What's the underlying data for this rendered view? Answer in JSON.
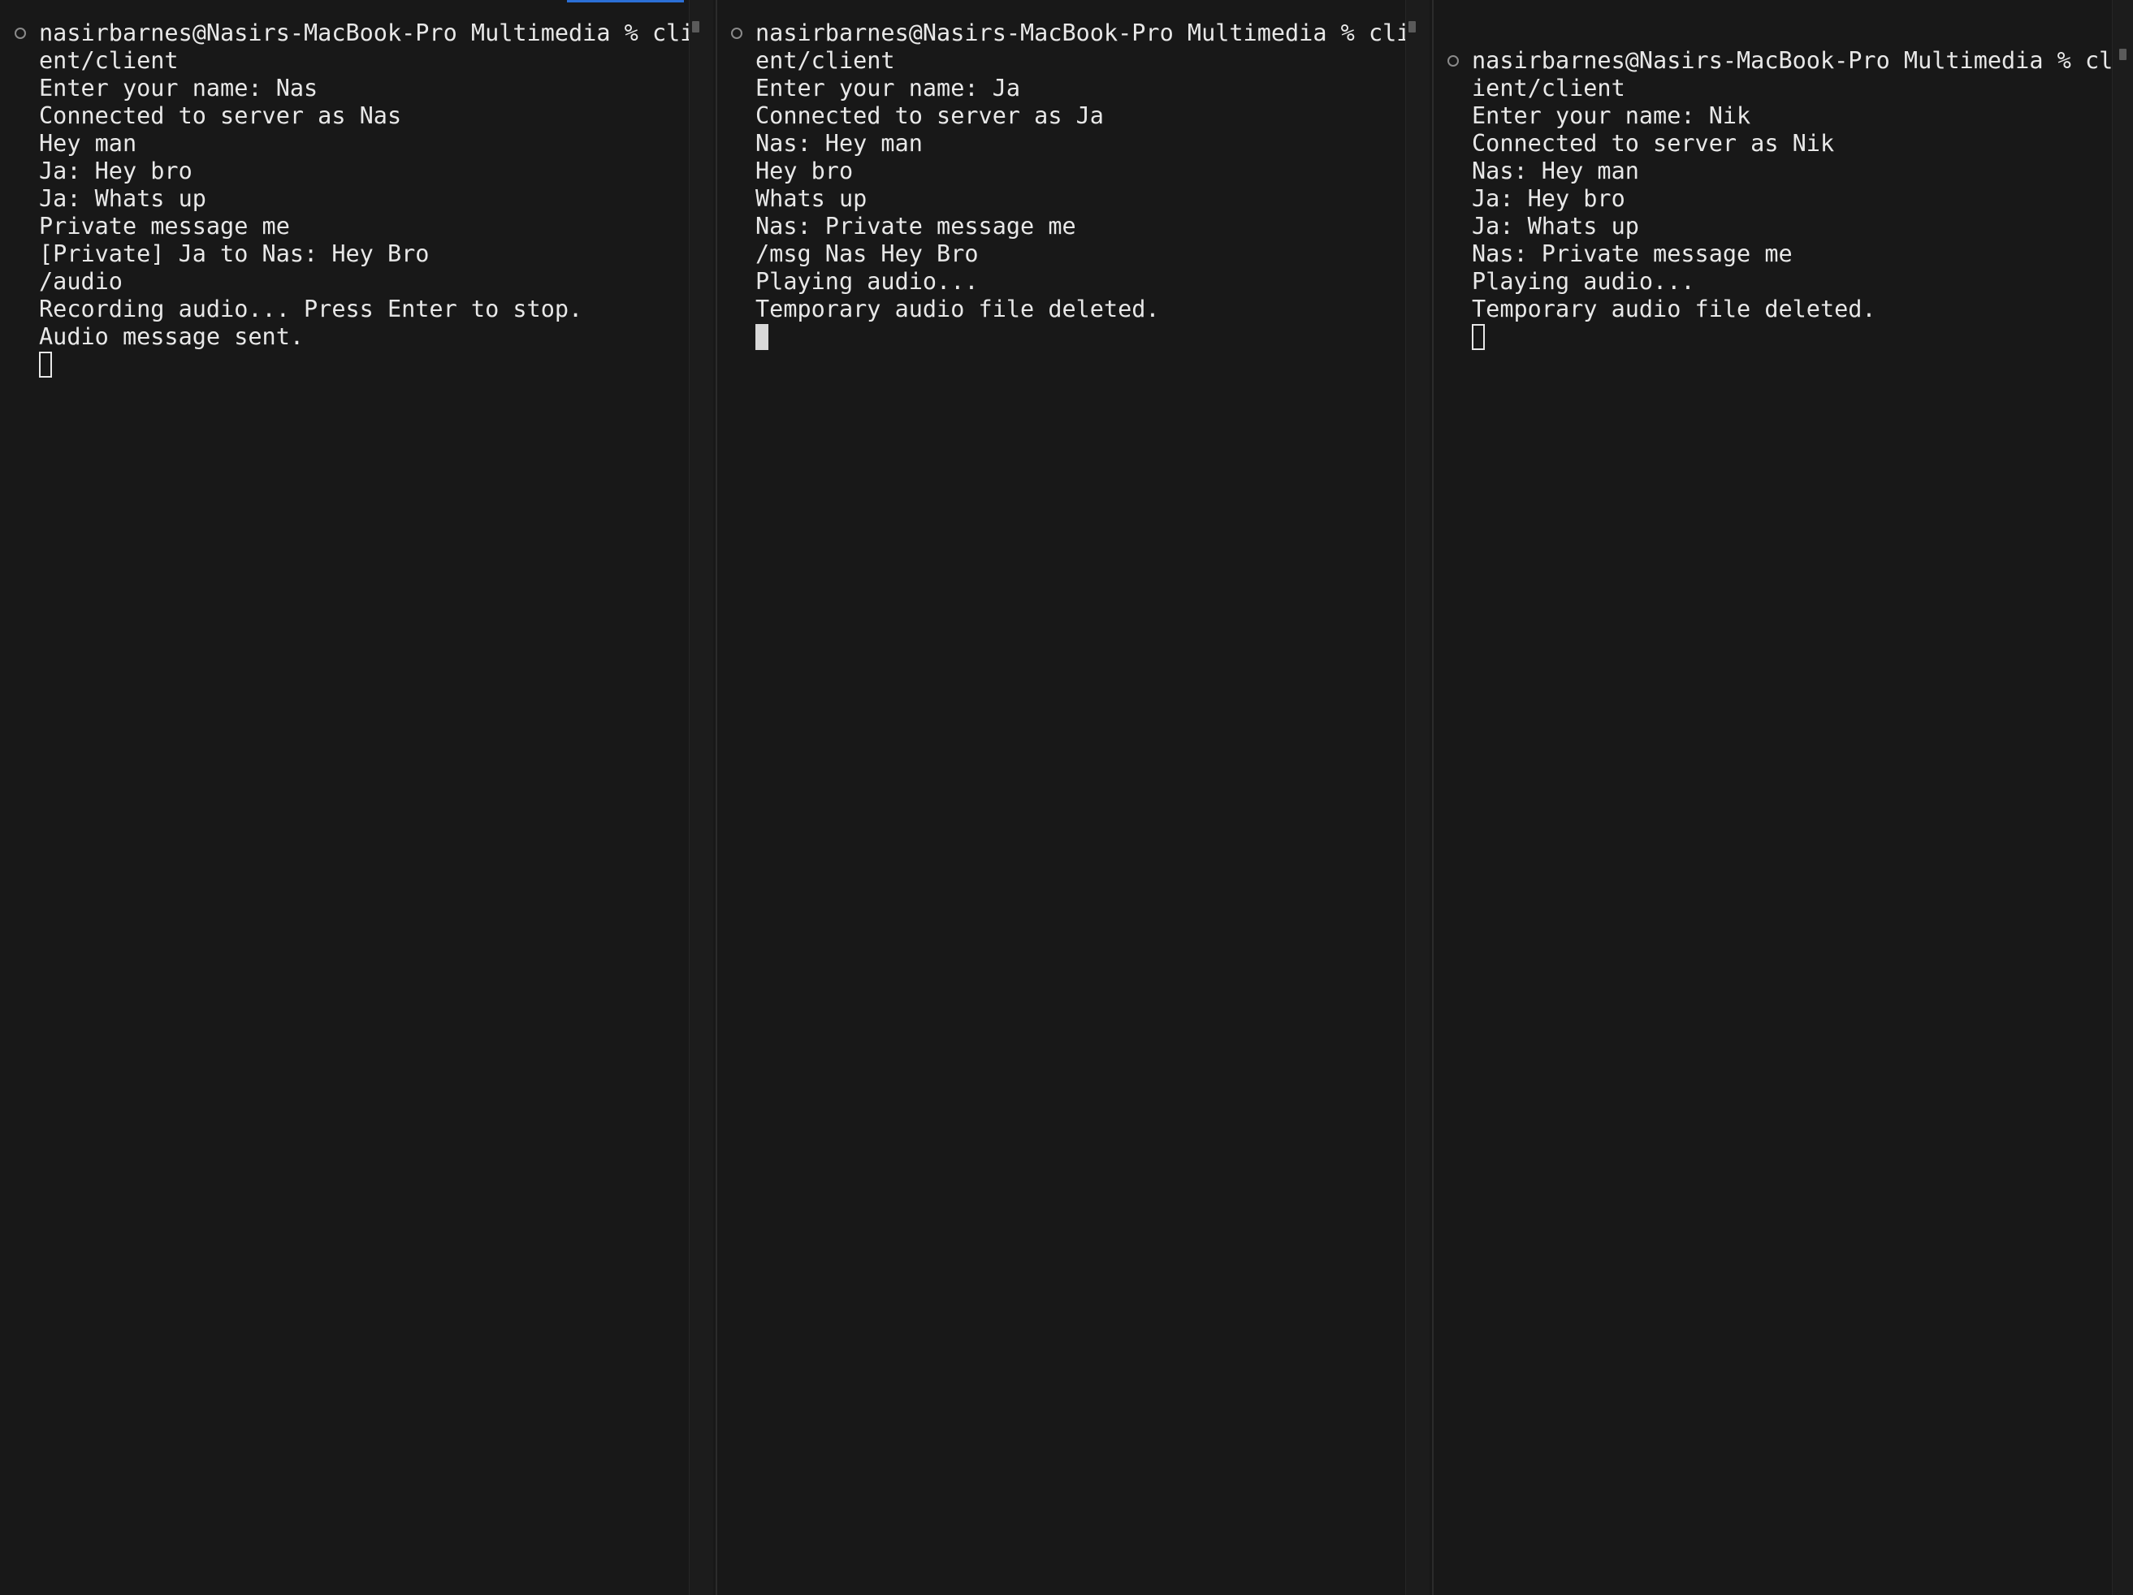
{
  "panes": [
    {
      "lines": [
        "nasirbarnes@Nasirs-MacBook-Pro Multimedia % cli",
        "ent/client",
        "Enter your name: Nas",
        "Connected to server as Nas",
        "Hey man",
        "Ja: Hey bro",
        "Ja: Whats up",
        "Private message me",
        "[Private] Ja to Nas: Hey Bro",
        "/audio",
        "Recording audio... Press Enter to stop.",
        "Audio message sent."
      ],
      "cursor_style": "hollow"
    },
    {
      "lines": [
        "nasirbarnes@Nasirs-MacBook-Pro Multimedia % cli",
        "ent/client",
        "Enter your name: Ja",
        "Connected to server as Ja",
        "Nas: Hey man",
        "Hey bro",
        "Whats up",
        "Nas: Private message me",
        "/msg Nas Hey Bro",
        "Playing audio...",
        "Temporary audio file deleted."
      ],
      "cursor_style": "solid"
    },
    {
      "lines": [
        "nasirbarnes@Nasirs-MacBook-Pro Multimedia % cl",
        "ient/client",
        "Enter your name: Nik",
        "Connected to server as Nik",
        "Nas: Hey man",
        "Ja: Hey bro",
        "Ja: Whats up",
        "Nas: Private message me",
        "Playing audio...",
        "Temporary audio file deleted."
      ],
      "cursor_style": "hollow"
    }
  ],
  "colors": {
    "background": "#181818",
    "text": "#e8e8e8",
    "active_tab_accent": "#2b6fd6"
  }
}
